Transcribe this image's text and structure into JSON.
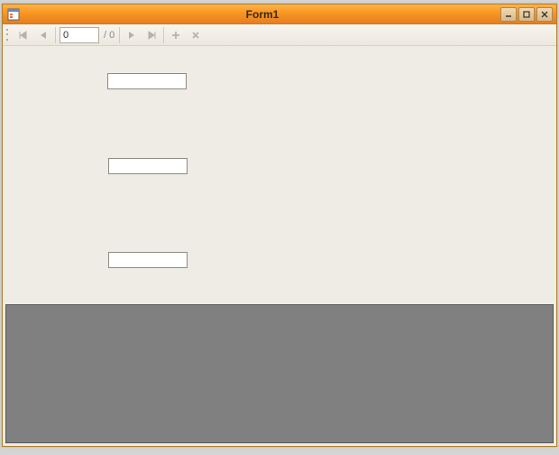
{
  "window": {
    "title": "Form1"
  },
  "titlebar_controls": {
    "minimize": "minimize",
    "maximize": "maximize",
    "close": "close"
  },
  "navigator": {
    "position_value": "0",
    "total_label": "/ 0"
  },
  "inputs": {
    "field1": "",
    "field2": "",
    "field3": ""
  }
}
